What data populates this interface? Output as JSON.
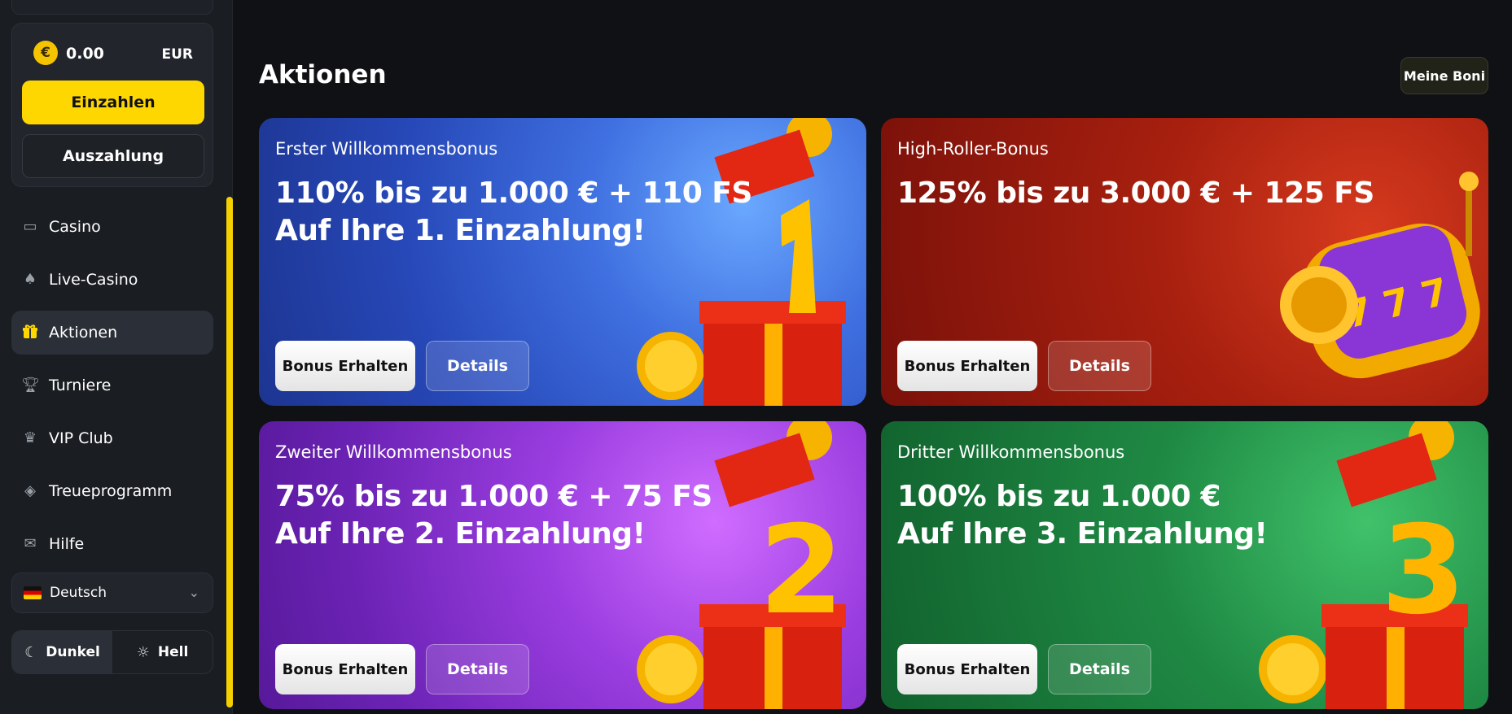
{
  "wallet": {
    "balance": "0.00",
    "currency": "EUR",
    "coin_symbol": "€",
    "deposit_label": "Einzahlen",
    "withdraw_label": "Auszahlung"
  },
  "nav": [
    {
      "label": "Casino",
      "icon": "slot-machine-icon"
    },
    {
      "label": "Live-Casino",
      "icon": "spade-icon"
    },
    {
      "label": "Aktionen",
      "icon": "gift-icon",
      "active": true
    },
    {
      "label": "Turniere",
      "icon": "trophy-icon"
    },
    {
      "label": "VIP Club",
      "icon": "crown-icon"
    },
    {
      "label": "Treueprogramm",
      "icon": "badge-icon"
    },
    {
      "label": "Hilfe",
      "icon": "mail-icon"
    }
  ],
  "language": {
    "label": "Deutsch"
  },
  "theme": {
    "dark_label": "Dunkel",
    "light_label": "Hell"
  },
  "page": {
    "title": "Aktionen",
    "my_bonuses_label": "Meine Boni"
  },
  "cards": [
    {
      "subtitle": "Erster Willkommensbonus",
      "line1": "110% bis zu 1.000 € + 110 FS",
      "line2": "Auf Ihre 1. Einzahlung!",
      "claim": "Bonus Erhalten",
      "details": "Details",
      "art_number": "1"
    },
    {
      "subtitle": "High-Roller-Bonus",
      "line1": "125% bis zu 3.000 € + 125 FS",
      "line2": "",
      "claim": "Bonus Erhalten",
      "details": "Details",
      "art_number": "777"
    },
    {
      "subtitle": "Zweiter Willkommensbonus",
      "line1": "75% bis zu 1.000 € + 75 FS",
      "line2": "Auf Ihre 2. Einzahlung!",
      "claim": "Bonus Erhalten",
      "details": "Details",
      "art_number": "2"
    },
    {
      "subtitle": "Dritter Willkommensbonus",
      "line1": "100% bis zu 1.000 €",
      "line2": "Auf Ihre 3. Einzahlung!",
      "claim": "Bonus Erhalten",
      "details": "Details",
      "art_number": "3"
    }
  ],
  "colors": {
    "accent": "#ffd700",
    "sidebar_bg": "#1a1d22",
    "page_bg": "#0f1114"
  }
}
